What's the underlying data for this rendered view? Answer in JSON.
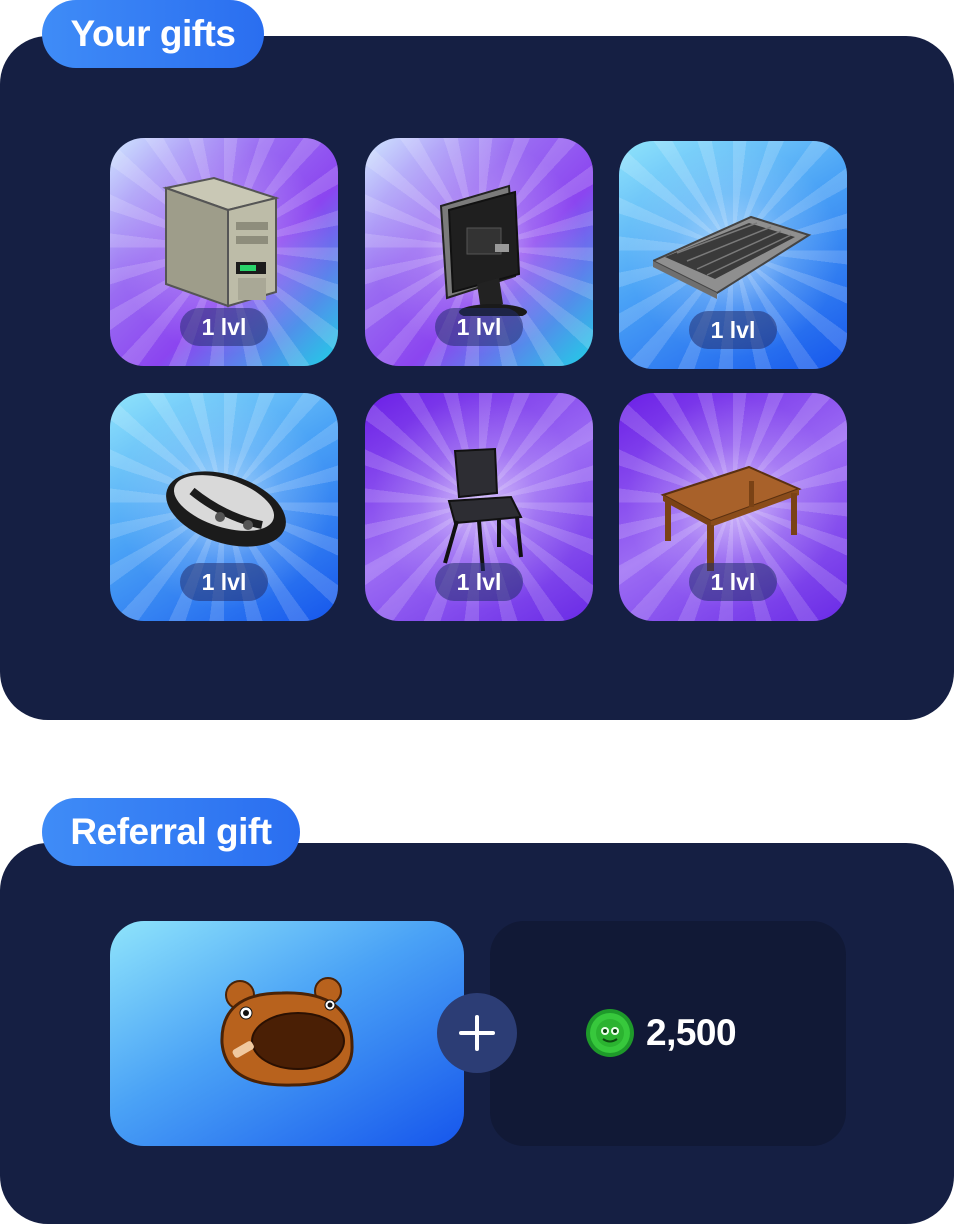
{
  "sections": {
    "your_gifts": {
      "title": "Your gifts"
    },
    "referral_gift": {
      "title": "Referral gift"
    }
  },
  "gifts": [
    {
      "item": "pc-tower-icon",
      "level_label": "1 lvl",
      "background": "violet-cyan"
    },
    {
      "item": "monitor-icon",
      "level_label": "1 lvl",
      "background": "violet-cyan"
    },
    {
      "item": "keyboard-icon",
      "level_label": "1 lvl",
      "background": "blue"
    },
    {
      "item": "mouse-icon",
      "level_label": "1 lvl",
      "background": "blue"
    },
    {
      "item": "chair-icon",
      "level_label": "1 lvl",
      "background": "violet"
    },
    {
      "item": "table-icon",
      "level_label": "1 lvl",
      "background": "violet"
    }
  ],
  "referral": {
    "item": "bear-hat-icon",
    "plus_icon": "plus-icon",
    "coin_icon": "green-coin-icon",
    "coin_amount": "2,500"
  },
  "colors": {
    "panel": "#151f43",
    "pill": "#3f8cf7",
    "coin_box": "#111936",
    "plus_button": "#2c3d75",
    "coin": "#37c83c"
  }
}
